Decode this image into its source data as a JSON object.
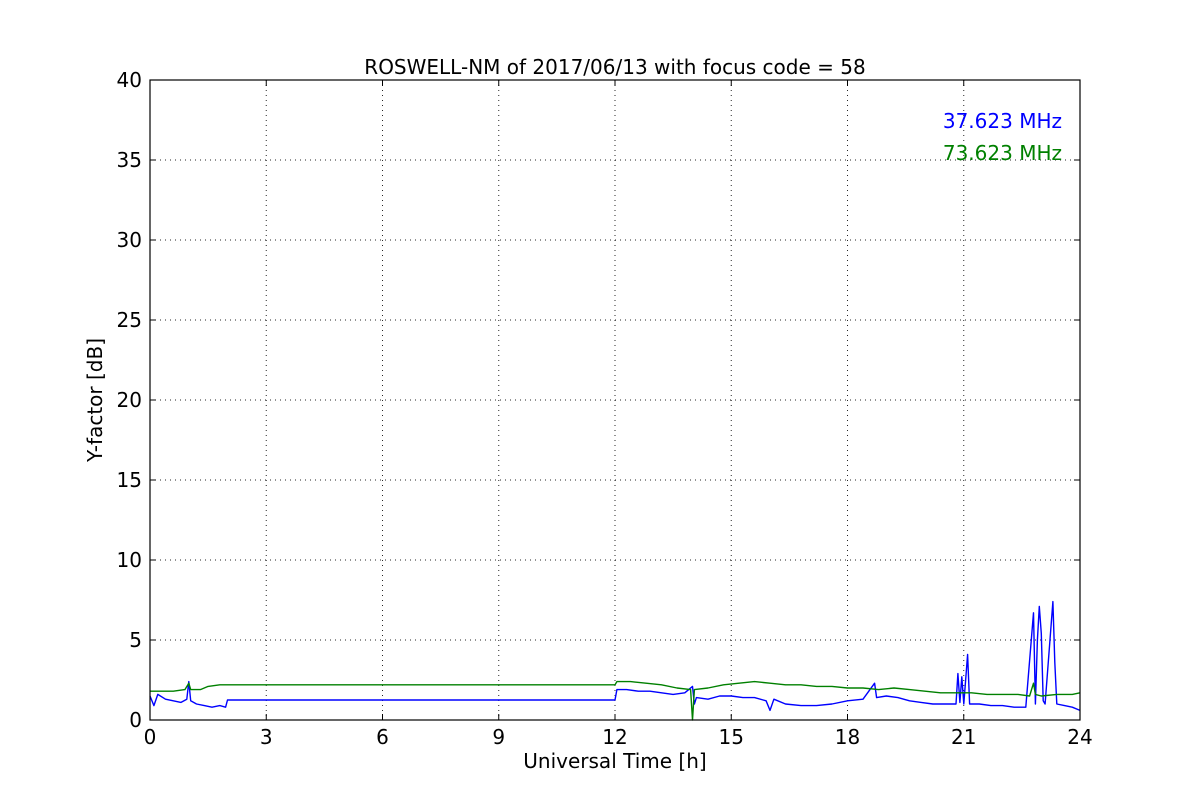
{
  "chart_data": {
    "type": "line",
    "title": "ROSWELL-NM of 2017/06/13 with focus code = 58",
    "xlabel": "Universal Time [h]",
    "ylabel": "Y-factor [dB]",
    "xlim": [
      0,
      24
    ],
    "ylim": [
      0,
      40
    ],
    "xticks": [
      0,
      3,
      6,
      9,
      12,
      15,
      18,
      21,
      24
    ],
    "yticks": [
      0,
      5,
      10,
      15,
      20,
      25,
      30,
      35,
      40
    ],
    "grid": true,
    "legend_position": "top-right",
    "series": [
      {
        "name": "37.623 MHz",
        "color": "#0000ff",
        "points": [
          [
            0.0,
            1.5
          ],
          [
            0.1,
            0.9
          ],
          [
            0.2,
            1.6
          ],
          [
            0.4,
            1.3
          ],
          [
            0.6,
            1.2
          ],
          [
            0.8,
            1.1
          ],
          [
            0.95,
            1.3
          ],
          [
            1.0,
            2.4
          ],
          [
            1.05,
            1.2
          ],
          [
            1.2,
            1.0
          ],
          [
            1.4,
            0.9
          ],
          [
            1.6,
            0.8
          ],
          [
            1.8,
            0.9
          ],
          [
            1.95,
            0.8
          ],
          [
            2.0,
            1.25
          ],
          [
            12.0,
            1.25
          ],
          [
            12.05,
            1.9
          ],
          [
            12.3,
            1.9
          ],
          [
            12.6,
            1.8
          ],
          [
            12.9,
            1.8
          ],
          [
            13.2,
            1.7
          ],
          [
            13.5,
            1.6
          ],
          [
            13.8,
            1.7
          ],
          [
            14.0,
            2.1
          ],
          [
            14.05,
            1.0
          ],
          [
            14.1,
            1.4
          ],
          [
            14.4,
            1.3
          ],
          [
            14.7,
            1.5
          ],
          [
            15.0,
            1.5
          ],
          [
            15.3,
            1.4
          ],
          [
            15.6,
            1.4
          ],
          [
            15.9,
            1.2
          ],
          [
            16.0,
            0.6
          ],
          [
            16.1,
            1.3
          ],
          [
            16.4,
            1.0
          ],
          [
            16.8,
            0.9
          ],
          [
            17.2,
            0.9
          ],
          [
            17.6,
            1.0
          ],
          [
            18.0,
            1.2
          ],
          [
            18.4,
            1.3
          ],
          [
            18.7,
            2.3
          ],
          [
            18.75,
            1.4
          ],
          [
            19.0,
            1.5
          ],
          [
            19.3,
            1.4
          ],
          [
            19.6,
            1.2
          ],
          [
            19.9,
            1.1
          ],
          [
            20.2,
            1.0
          ],
          [
            20.5,
            1.0
          ],
          [
            20.8,
            1.0
          ],
          [
            20.85,
            2.9
          ],
          [
            20.9,
            1.1
          ],
          [
            20.95,
            2.7
          ],
          [
            21.0,
            1.0
          ],
          [
            21.1,
            4.1
          ],
          [
            21.15,
            1.0
          ],
          [
            21.4,
            1.0
          ],
          [
            21.7,
            0.9
          ],
          [
            22.0,
            0.9
          ],
          [
            22.3,
            0.8
          ],
          [
            22.6,
            0.8
          ],
          [
            22.8,
            6.7
          ],
          [
            22.85,
            1.0
          ],
          [
            22.9,
            5.0
          ],
          [
            22.95,
            7.1
          ],
          [
            23.0,
            5.4
          ],
          [
            23.05,
            1.2
          ],
          [
            23.1,
            1.0
          ],
          [
            23.3,
            7.4
          ],
          [
            23.35,
            3.6
          ],
          [
            23.4,
            1.0
          ],
          [
            23.6,
            0.9
          ],
          [
            23.8,
            0.8
          ],
          [
            24.0,
            0.6
          ]
        ]
      },
      {
        "name": "73.623 MHz",
        "color": "#008000",
        "points": [
          [
            0.0,
            1.8
          ],
          [
            0.3,
            1.8
          ],
          [
            0.6,
            1.8
          ],
          [
            0.9,
            1.9
          ],
          [
            1.0,
            2.3
          ],
          [
            1.05,
            1.9
          ],
          [
            1.3,
            1.9
          ],
          [
            1.5,
            2.1
          ],
          [
            1.8,
            2.2
          ],
          [
            1.95,
            2.2
          ],
          [
            2.0,
            2.2
          ],
          [
            12.0,
            2.2
          ],
          [
            12.05,
            2.4
          ],
          [
            12.4,
            2.4
          ],
          [
            12.8,
            2.3
          ],
          [
            13.2,
            2.2
          ],
          [
            13.6,
            2.0
          ],
          [
            13.95,
            1.9
          ],
          [
            14.0,
            0.0
          ],
          [
            14.05,
            1.9
          ],
          [
            14.4,
            2.0
          ],
          [
            14.8,
            2.2
          ],
          [
            15.2,
            2.3
          ],
          [
            15.6,
            2.4
          ],
          [
            16.0,
            2.3
          ],
          [
            16.4,
            2.2
          ],
          [
            16.8,
            2.2
          ],
          [
            17.2,
            2.1
          ],
          [
            17.6,
            2.1
          ],
          [
            18.0,
            2.0
          ],
          [
            18.4,
            2.0
          ],
          [
            18.8,
            1.9
          ],
          [
            19.2,
            2.0
          ],
          [
            19.6,
            1.9
          ],
          [
            20.0,
            1.8
          ],
          [
            20.4,
            1.7
          ],
          [
            20.8,
            1.7
          ],
          [
            21.2,
            1.7
          ],
          [
            21.6,
            1.6
          ],
          [
            22.0,
            1.6
          ],
          [
            22.4,
            1.6
          ],
          [
            22.7,
            1.5
          ],
          [
            22.8,
            2.3
          ],
          [
            22.85,
            1.6
          ],
          [
            23.0,
            1.5
          ],
          [
            23.4,
            1.6
          ],
          [
            23.8,
            1.6
          ],
          [
            24.0,
            1.7
          ]
        ]
      }
    ]
  }
}
